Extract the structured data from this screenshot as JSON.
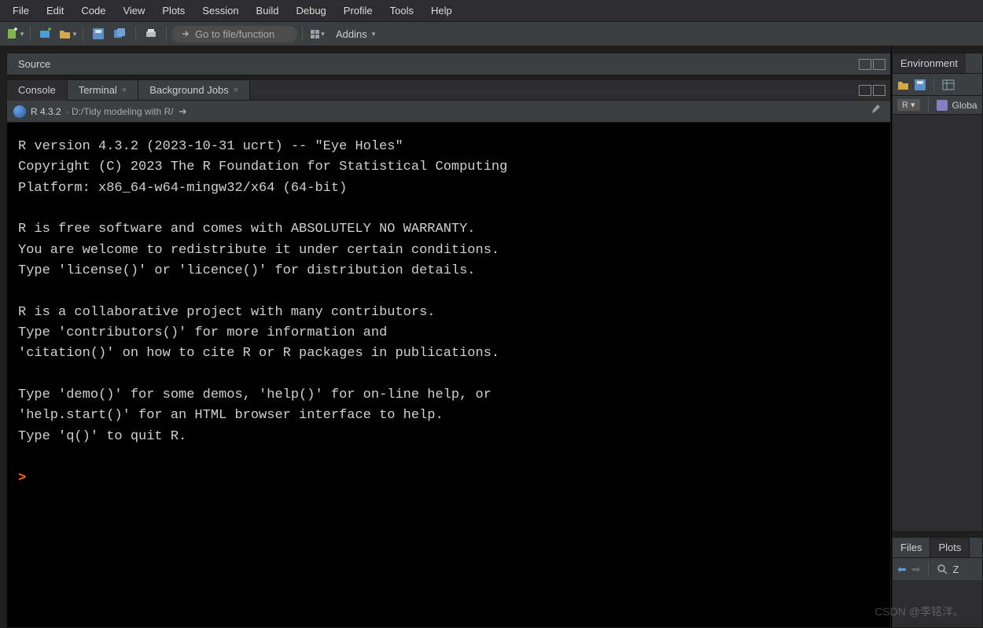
{
  "menubar": [
    "File",
    "Edit",
    "Code",
    "View",
    "Plots",
    "Session",
    "Build",
    "Debug",
    "Profile",
    "Tools",
    "Help"
  ],
  "toolbar": {
    "goto_placeholder": "Go to file/function",
    "addins_label": "Addins"
  },
  "source_pane": {
    "title": "Source"
  },
  "console": {
    "tabs": [
      {
        "label": "Console",
        "closable": false,
        "active": true
      },
      {
        "label": "Terminal",
        "closable": true,
        "active": false
      },
      {
        "label": "Background Jobs",
        "closable": true,
        "active": false
      }
    ],
    "r_version": "R 4.3.2",
    "working_dir": "D:/Tidy modeling with R/",
    "output": "R version 4.3.2 (2023-10-31 ucrt) -- \"Eye Holes\"\nCopyright (C) 2023 The R Foundation for Statistical Computing\nPlatform: x86_64-w64-mingw32/x64 (64-bit)\n\nR is free software and comes with ABSOLUTELY NO WARRANTY.\nYou are welcome to redistribute it under certain conditions.\nType 'license()' or 'licence()' for distribution details.\n\nR is a collaborative project with many contributors.\nType 'contributors()' for more information and\n'citation()' on how to cite R or R packages in publications.\n\nType 'demo()' for some demos, 'help()' for on-line help, or\n'help.start()' for an HTML browser interface to help.\nType 'q()' to quit R.\n",
    "prompt": ">"
  },
  "environment": {
    "tab_label": "Environment",
    "scope_r": "R",
    "scope_global": "Globa"
  },
  "files_pane": {
    "tabs": [
      {
        "label": "Files",
        "active": false
      },
      {
        "label": "Plots",
        "active": true
      }
    ],
    "zoom_label": "Z"
  },
  "watermark": "CSDN @李铭洋。"
}
